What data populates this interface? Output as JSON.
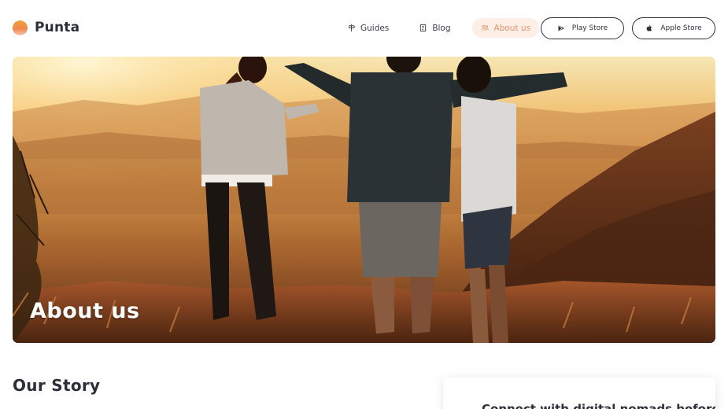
{
  "brand": {
    "name": "Punta"
  },
  "nav": {
    "guides": "Guides",
    "blog": "Blog",
    "about": "About us"
  },
  "stores": {
    "play": "Play Store",
    "apple": "Apple Store"
  },
  "hero": {
    "title": "About us"
  },
  "story": {
    "title": "Our Story"
  },
  "card": {
    "title": "Connect with digital nomads before"
  },
  "colors": {
    "accent": "#e79470",
    "accent_bg": "#fdeee6",
    "text": "#2a2f3a"
  },
  "icons": {
    "guides": "signpost-icon",
    "blog": "notebook-icon",
    "about": "people-icon",
    "play": "play-store-icon",
    "apple": "apple-icon"
  }
}
